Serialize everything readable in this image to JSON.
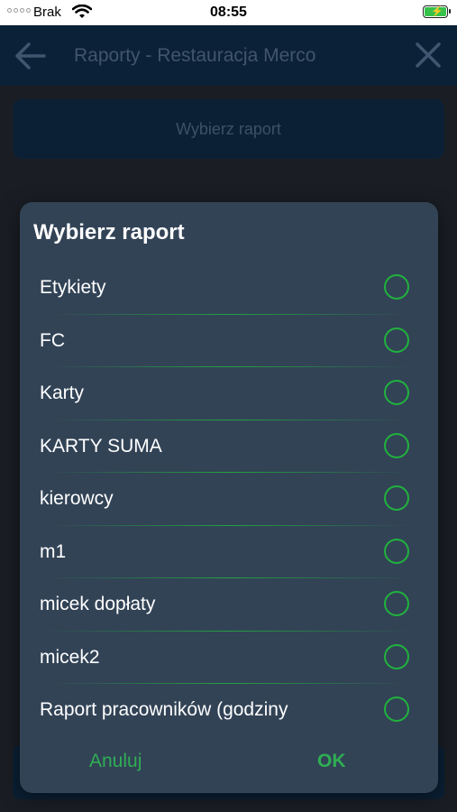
{
  "status_bar": {
    "carrier": "Brak",
    "time": "08:55"
  },
  "app_bar": {
    "title": "Raporty - Restauracja Merco"
  },
  "main": {
    "select_button": "Wybierz raport"
  },
  "dialog": {
    "title": "Wybierz raport",
    "options": [
      {
        "label": "Etykiety"
      },
      {
        "label": "FC"
      },
      {
        "label": "Karty"
      },
      {
        "label": "KARTY SUMA"
      },
      {
        "label": "kierowcy"
      },
      {
        "label": "m1"
      },
      {
        "label": "micek dopłaty"
      },
      {
        "label": "micek2"
      },
      {
        "label": "Raport pracowników (godziny"
      }
    ],
    "cancel": "Anuluj",
    "ok": "OK"
  },
  "colors": {
    "accent": "#21b23d",
    "dialog_bg": "#324356",
    "app_bar_bg": "#0b2137"
  }
}
